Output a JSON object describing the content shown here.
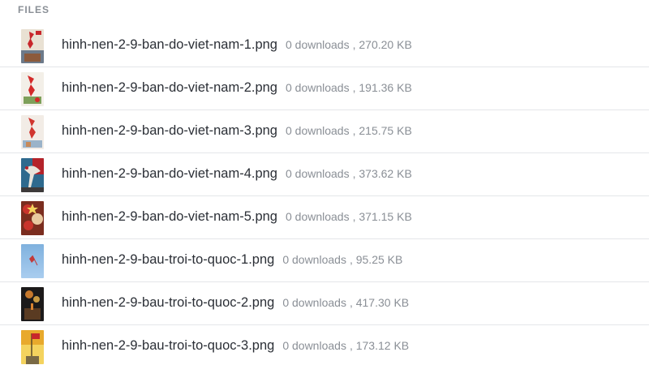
{
  "section": {
    "label": "FILES"
  },
  "files": [
    {
      "name": "hinh-nen-2-9-ban-do-viet-nam-1.png",
      "downloads": "0 downloads",
      "size": "270.20 KB",
      "thumb_icon": "image-thumbnail-map-icon",
      "thumb_colors": [
        "#c8262b",
        "#e9e1d3",
        "#6d7a8a"
      ]
    },
    {
      "name": "hinh-nen-2-9-ban-do-viet-nam-2.png",
      "downloads": "0 downloads",
      "size": "191.36 KB",
      "thumb_icon": "image-thumbnail-map-icon",
      "thumb_colors": [
        "#d42a2a",
        "#f3efe8",
        "#7ea05a"
      ]
    },
    {
      "name": "hinh-nen-2-9-ban-do-viet-nam-3.png",
      "downloads": "0 downloads",
      "size": "215.75 KB",
      "thumb_icon": "image-thumbnail-map-icon",
      "thumb_colors": [
        "#d0352f",
        "#f2ece6",
        "#9bb3c9"
      ]
    },
    {
      "name": "hinh-nen-2-9-ban-do-viet-nam-4.png",
      "downloads": "0 downloads",
      "size": "373.62 KB",
      "thumb_icon": "image-thumbnail-crane-icon",
      "thumb_colors": [
        "#b4232a",
        "#2e6a8e",
        "#e8e4dc"
      ]
    },
    {
      "name": "hinh-nen-2-9-ban-do-viet-nam-5.png",
      "downloads": "0 downloads",
      "size": "371.15 KB",
      "thumb_icon": "image-thumbnail-flowers-icon",
      "thumb_colors": [
        "#c9342c",
        "#e9c9a0",
        "#7b2d1f"
      ]
    },
    {
      "name": "hinh-nen-2-9-bau-troi-to-quoc-1.png",
      "downloads": "0 downloads",
      "size": "95.25 KB",
      "thumb_icon": "image-thumbnail-sky-icon",
      "thumb_colors": [
        "#7fb1de",
        "#a9cdef",
        "#c23b3b"
      ]
    },
    {
      "name": "hinh-nen-2-9-bau-troi-to-quoc-2.png",
      "downloads": "0 downloads",
      "size": "417.30 KB",
      "thumb_icon": "image-thumbnail-fireworks-icon",
      "thumb_colors": [
        "#1c1a1a",
        "#d9832f",
        "#5a3b22"
      ]
    },
    {
      "name": "hinh-nen-2-9-bau-troi-to-quoc-3.png",
      "downloads": "0 downloads",
      "size": "173.12 KB",
      "thumb_icon": "image-thumbnail-flag-icon",
      "thumb_colors": [
        "#e8a92c",
        "#f4d35e",
        "#c8262b"
      ]
    }
  ]
}
